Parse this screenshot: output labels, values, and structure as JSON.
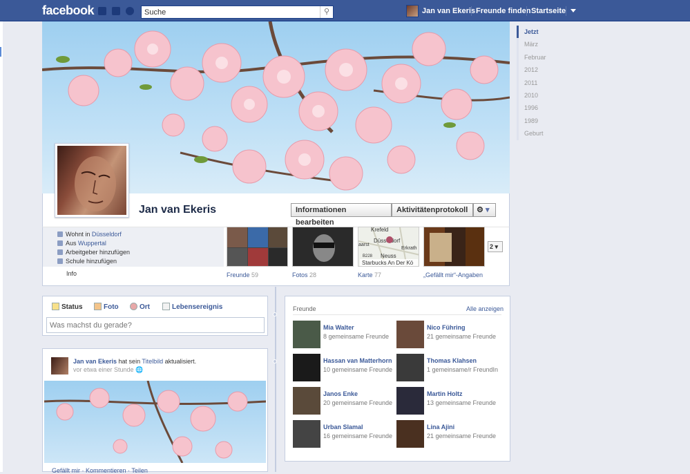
{
  "topbar": {
    "logo": "facebook",
    "search_placeholder": "Suche",
    "user_name": "Jan van Ekeris",
    "find_friends": "Freunde finden",
    "home": "Startseite"
  },
  "timeline_nav": [
    "Jetzt",
    "März",
    "Februar",
    "2012",
    "2011",
    "2010",
    "1996",
    "1989",
    "Geburt"
  ],
  "profile": {
    "name": "Jan van Ekeris",
    "edit_info": "Informationen bearbeiten",
    "activity_log": "Aktivitätenprotokoll",
    "settings_icon": "gear-icon"
  },
  "info": {
    "lives_prefix": "Wohnt in ",
    "lives_city": "Düsseldorf",
    "from_prefix": "Aus ",
    "from_city": "Wuppertal",
    "add_employer": "Arbeitgeber hinzufügen",
    "add_school": "Schule hinzufügen",
    "info_link": "Info"
  },
  "sections": [
    {
      "label": "Freunde",
      "count": "59"
    },
    {
      "label": "Fotos",
      "count": "28"
    },
    {
      "label": "Karte",
      "count": "77"
    },
    {
      "label": "„Gefällt mir“-Angaben",
      "count": ""
    }
  ],
  "map": {
    "city_top": "Krefeld",
    "city_main": "Düsseldorf",
    "city_right": "Erkrath",
    "city_left": "aarst",
    "city_bottom": "Neuss",
    "road": "B228",
    "place": "Starbucks An Der Kö"
  },
  "more_sections": "2",
  "composer": {
    "tabs": [
      "Status",
      "Foto",
      "Ort",
      "Lebensereignis"
    ],
    "placeholder": "Was machst du gerade?"
  },
  "post": {
    "author": "Jan van Ekeris",
    "text_mid": " hat sein ",
    "text_link": "Titelbild",
    "text_end": " aktualisiert.",
    "time": "vor etwa einer Stunde",
    "actions": "Gefällt mir · Kommentieren · Teilen"
  },
  "friends_box": {
    "title": "Freunde",
    "see_all": "Alle anzeigen",
    "items": [
      {
        "name": "Mia Walter",
        "mutual": "8 gemeinsame Freunde"
      },
      {
        "name": "Nico Führing",
        "mutual": "21 gemeinsame Freunde"
      },
      {
        "name": "Hassan van Matterhorn",
        "mutual": "10 gemeinsame Freunde"
      },
      {
        "name": "Thomas Klahsen",
        "mutual": "1 gemeinsame/r FreundIn"
      },
      {
        "name": "Janos Enke",
        "mutual": "20 gemeinsame Freunde"
      },
      {
        "name": "Martin Holtz",
        "mutual": "13 gemeinsame Freunde"
      },
      {
        "name": "Urban Slamal",
        "mutual": "16 gemeinsame Freunde"
      },
      {
        "name": "Lina Ajini",
        "mutual": "21 gemeinsame Freunde"
      }
    ]
  },
  "colors": {
    "brand": "#3b5998",
    "background": "#e9ebf2",
    "blossom": "#f4b6c2",
    "sky": "#9ecff0"
  }
}
